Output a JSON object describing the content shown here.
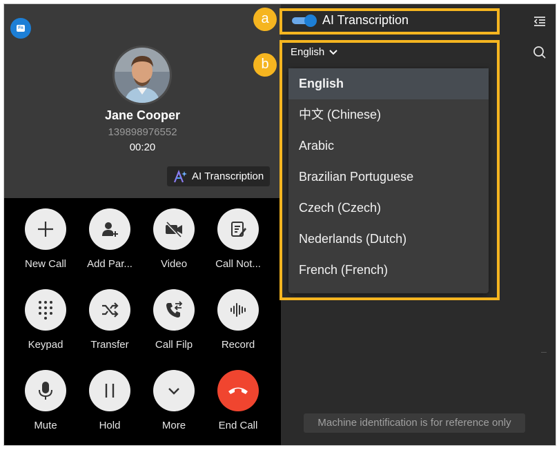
{
  "caller": {
    "name": "Jane Cooper",
    "number": "139898976552",
    "duration": "00:20"
  },
  "ai_badge_label": "AI Transcription",
  "buttons": [
    {
      "label": "New Call",
      "icon": "plus-icon"
    },
    {
      "label": "Add Par...",
      "icon": "add-participant-icon"
    },
    {
      "label": "Video",
      "icon": "video-off-icon"
    },
    {
      "label": "Call Not...",
      "icon": "note-icon"
    },
    {
      "label": "Keypad",
      "icon": "keypad-icon"
    },
    {
      "label": "Transfer",
      "icon": "transfer-icon"
    },
    {
      "label": "Call Filp",
      "icon": "call-flip-icon"
    },
    {
      "label": "Record",
      "icon": "record-waveform-icon"
    },
    {
      "label": "Mute",
      "icon": "microphone-icon"
    },
    {
      "label": "Hold",
      "icon": "pause-icon"
    },
    {
      "label": "More",
      "icon": "chevron-down-icon"
    },
    {
      "label": "End Call",
      "icon": "hang-up-icon"
    }
  ],
  "transcription": {
    "toggle_label": "AI Transcription",
    "toggle_on": true,
    "selected_language": "English",
    "languages": [
      "English",
      "中文 (Chinese)",
      "Arabic",
      "Brazilian Portuguese",
      "Czech (Czech)",
      "Nederlands (Dutch)",
      "French (French)"
    ]
  },
  "callouts": {
    "a": "a",
    "b": "b"
  },
  "notice": "Machine identification is for reference only",
  "colors": {
    "accent": "#1d7fd6",
    "highlight": "#f5b520",
    "end_call": "#f0452f"
  }
}
